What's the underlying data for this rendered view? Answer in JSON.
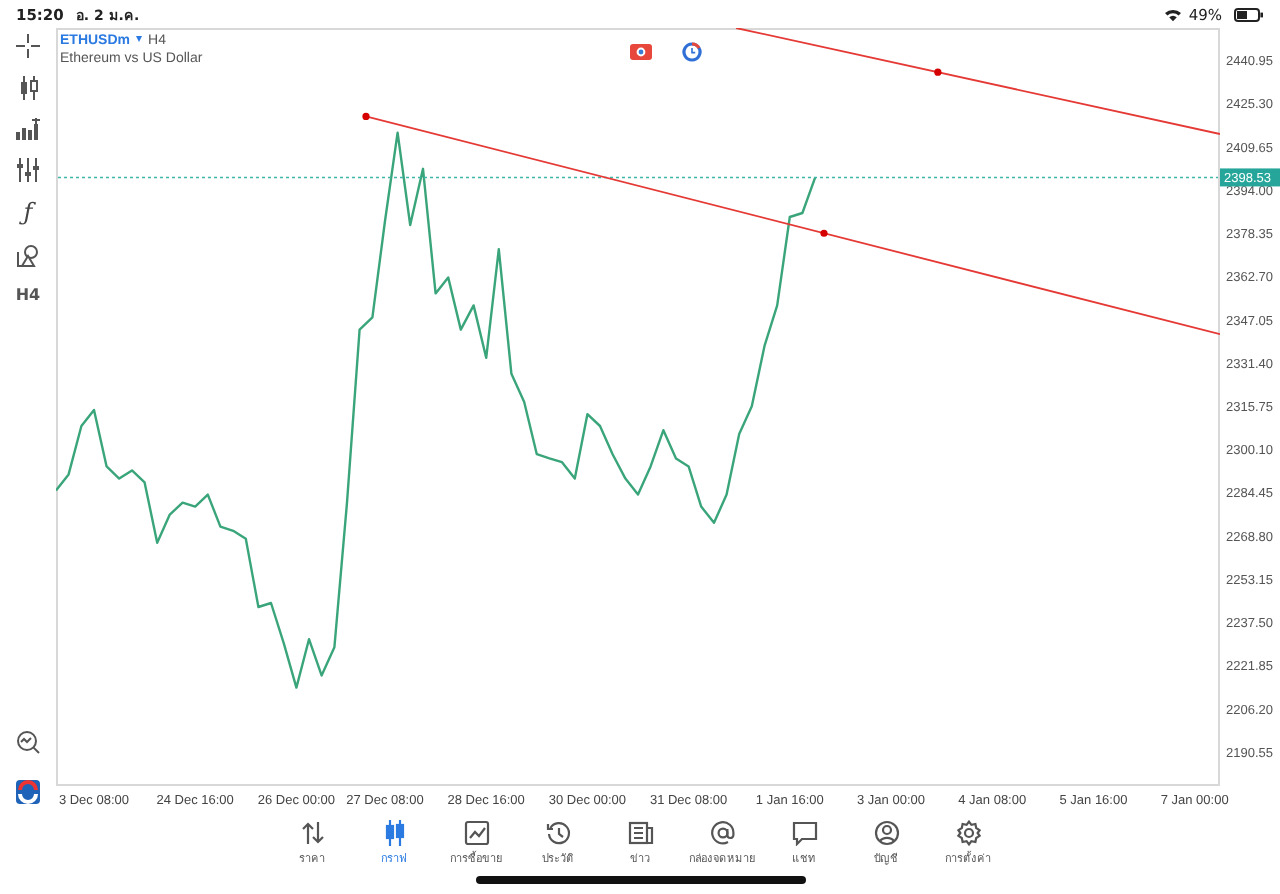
{
  "status_bar": {
    "time": "15:20",
    "date": "อ. 2 ม.ค.",
    "battery": "49%"
  },
  "left_toolbar": {
    "function_glyph": "ƒ",
    "timeframe": "H4"
  },
  "chart_header": {
    "symbol": "ETHUSDm",
    "caret": "▾",
    "timeframe": "H4",
    "description": "Ethereum vs US Dollar"
  },
  "chart": {
    "last_price": "2398.53",
    "chart_data": {
      "type": "line",
      "ylim": [
        2178.9,
        2452.6
      ],
      "categories": [
        null,
        null,
        null,
        "3 Dec 08:00",
        null,
        null,
        null,
        null,
        null,
        null,
        null,
        "24 Dec 16:00",
        null,
        null,
        null,
        null,
        null,
        null,
        null,
        "26 Dec 00:00",
        null,
        null,
        null,
        null,
        null,
        null,
        "27 Dec 08:00",
        null,
        null,
        null,
        null,
        null,
        null,
        null,
        "28 Dec 16:00",
        null,
        null,
        null,
        null,
        null,
        null,
        null,
        "30 Dec 00:00",
        null,
        null,
        null,
        null,
        null,
        null,
        null,
        "31 Dec 08:00",
        null,
        null,
        null,
        null,
        null,
        null,
        null,
        "1 Jan 16:00",
        null,
        null,
        null,
        null,
        null,
        null,
        null,
        "3 Jan 00:00",
        null,
        null,
        null,
        null,
        null,
        null,
        null,
        "4 Jan 08:00",
        null,
        null,
        null,
        null,
        null,
        null,
        null,
        "5 Jan 16:00",
        null,
        null,
        null,
        null,
        null,
        null,
        null,
        "7 Jan 00:00",
        null
      ],
      "series": [
        {
          "color": "#3aa57a",
          "values": [
            2285.2,
            2291.0,
            2308.5,
            2314.3,
            2293.9,
            2289.5,
            2292.4,
            2288.1,
            2266.2,
            2276.4,
            2280.8,
            2279.3,
            2283.7,
            2272.1,
            2270.6,
            2267.7,
            2243.0,
            2244.4,
            2229.8,
            2213.8,
            2231.3,
            2218.2,
            2228.4,
            2280.8,
            2343.4,
            2347.8,
            2382.7,
            2414.7,
            2381.3,
            2401.6,
            2356.5,
            2362.3,
            2343.4,
            2352.2,
            2333.2,
            2372.5,
            2327.4,
            2317.2,
            2298.3,
            2296.8,
            2295.4,
            2289.5,
            2312.8,
            2308.5,
            2298.3,
            2289.5,
            2283.7,
            2293.9,
            2307.0,
            2296.8,
            2293.9,
            2279.3,
            2273.5,
            2283.7,
            2305.6,
            2315.7,
            2337.6,
            2352.2,
            2384.2,
            2385.6,
            2398.5,
            null,
            null,
            null,
            null,
            null,
            null,
            null,
            null,
            null,
            null,
            null,
            null,
            null,
            null,
            null,
            null,
            null,
            null,
            null,
            null,
            null,
            null,
            null,
            null,
            null,
            null,
            null,
            null,
            null,
            null,
            null
          ]
        }
      ],
      "yticks": [
        {
          "value": 2440.95,
          "label": "2440.95"
        },
        {
          "value": 2425.3,
          "label": "2425.30"
        },
        {
          "value": 2409.65,
          "label": "2409.65"
        },
        {
          "value": 2394.0,
          "label": "2394.00"
        },
        {
          "value": 2378.35,
          "label": "2378.35"
        },
        {
          "value": 2362.7,
          "label": "2362.70"
        },
        {
          "value": 2347.05,
          "label": "2347.05"
        },
        {
          "value": 2331.4,
          "label": "2331.40"
        },
        {
          "value": 2315.75,
          "label": "2315.75"
        },
        {
          "value": 2300.1,
          "label": "2300.10"
        },
        {
          "value": 2284.45,
          "label": "2284.45"
        },
        {
          "value": 2268.8,
          "label": "2268.80"
        },
        {
          "value": 2253.15,
          "label": "2253.15"
        },
        {
          "value": 2237.5,
          "label": "2237.50"
        },
        {
          "value": 2221.85,
          "label": "2221.85"
        },
        {
          "value": 2206.2,
          "label": "2206.20"
        },
        {
          "value": 2190.55,
          "label": "2190.55"
        }
      ]
    }
  },
  "tabs": [
    {
      "kind": "quotes",
      "label": "ราคา",
      "selected": false
    },
    {
      "kind": "chart",
      "label": "กราฟ",
      "selected": true
    },
    {
      "kind": "trade",
      "label": "การซื้อขาย",
      "selected": false
    },
    {
      "kind": "history",
      "label": "ประวัติ",
      "selected": false
    },
    {
      "kind": "news",
      "label": "ข่าว",
      "selected": false
    },
    {
      "kind": "mail",
      "label": "กล่องจดหมาย",
      "selected": false
    },
    {
      "kind": "chat",
      "label": "แชท",
      "selected": false
    },
    {
      "kind": "account",
      "label": "บัญชี",
      "selected": false
    },
    {
      "kind": "settings",
      "label": "การตั้งค่า",
      "selected": false
    }
  ]
}
